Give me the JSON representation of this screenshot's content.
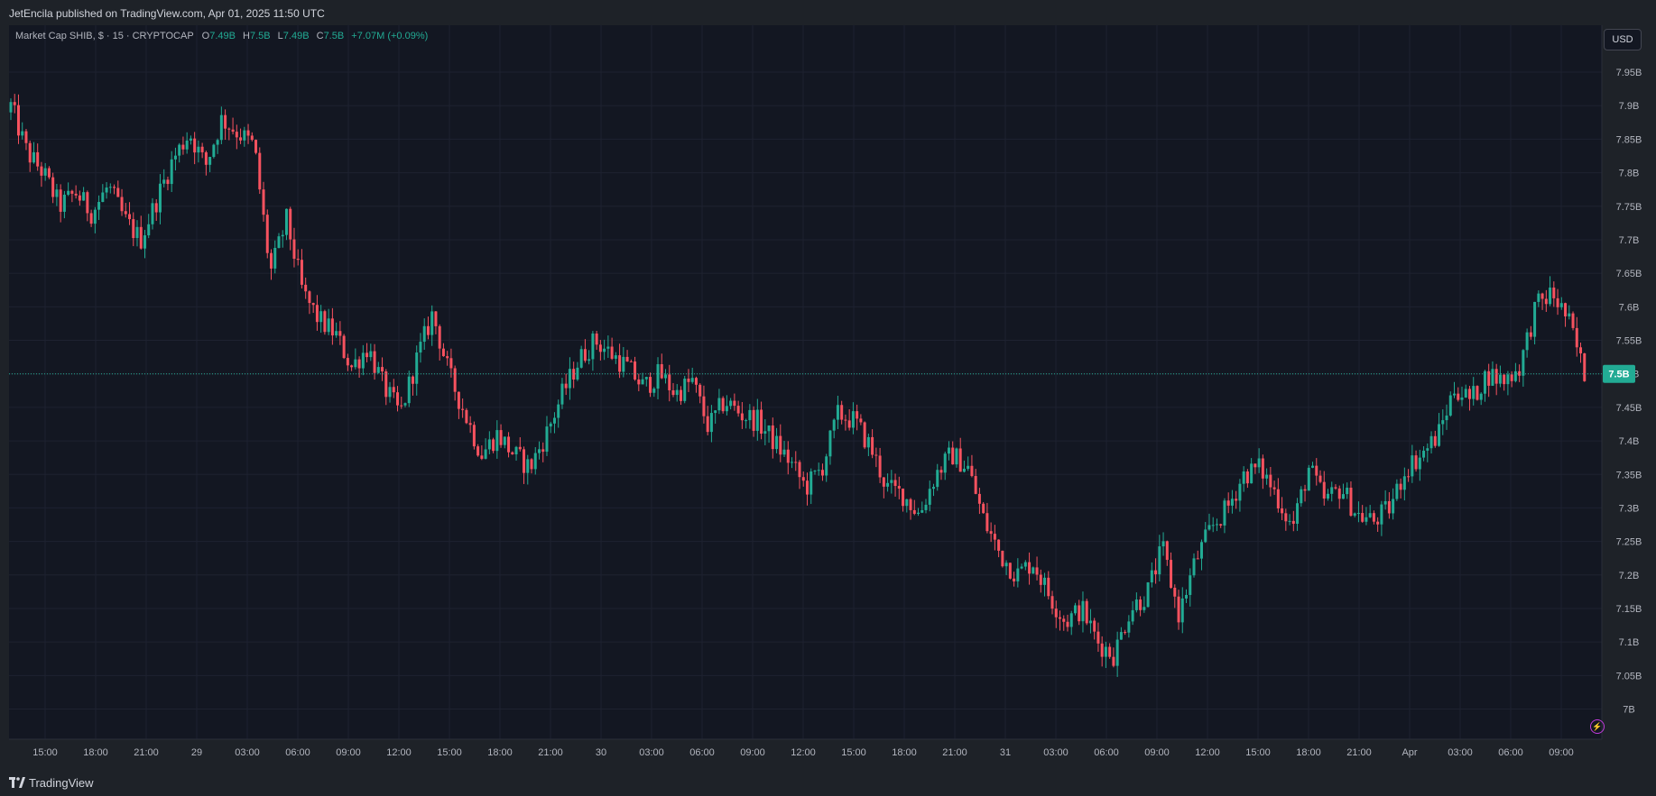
{
  "header": {
    "publisher": "JetEncila published on TradingView.com, Apr 01, 2025 11:50 UTC"
  },
  "legend": {
    "symbol": "Market Cap SHIB, $ · 15 · CRYPTOCAP",
    "o_label": "O",
    "o_value": "7.49B",
    "h_label": "H",
    "h_value": "7.5B",
    "l_label": "L",
    "l_value": "7.49B",
    "c_label": "C",
    "c_value": "7.5B",
    "change": "+7.07M (+0.09%)"
  },
  "currency_button": "USD",
  "footer": {
    "brand": "TradingView"
  },
  "colors": {
    "up": "#22ab94",
    "down": "#f7525f",
    "background": "#131722",
    "grid": "#1e2230"
  },
  "chart_data": {
    "type": "candlestick",
    "y_unit": "B",
    "ylim": [
      6.955,
      8.02
    ],
    "yticks": [
      "7B",
      "7.05B",
      "7.1B",
      "7.15B",
      "7.2B",
      "7.25B",
      "7.3B",
      "7.35B",
      "7.4B",
      "7.45B",
      "7.5B",
      "7.55B",
      "7.6B",
      "7.65B",
      "7.7B",
      "7.75B",
      "7.8B",
      "7.85B",
      "7.9B",
      "7.95B"
    ],
    "xticks": [
      "15:00",
      "18:00",
      "21:00",
      "29",
      "03:00",
      "06:00",
      "09:00",
      "12:00",
      "15:00",
      "18:00",
      "21:00",
      "30",
      "03:00",
      "06:00",
      "09:00",
      "12:00",
      "15:00",
      "18:00",
      "21:00",
      "31",
      "03:00",
      "06:00",
      "09:00",
      "12:00",
      "15:00",
      "18:00",
      "21:00",
      "Apr",
      "03:00",
      "06:00",
      "09:00"
    ],
    "last_price": 7.5,
    "last_price_label": "7.5B",
    "close_path": [
      7.9,
      7.83,
      7.8,
      7.75,
      7.77,
      7.74,
      7.78,
      7.73,
      7.7,
      7.76,
      7.82,
      7.86,
      7.81,
      7.88,
      7.86,
      7.84,
      7.65,
      7.73,
      7.62,
      7.58,
      7.56,
      7.51,
      7.54,
      7.48,
      7.44,
      7.52,
      7.59,
      7.5,
      7.44,
      7.38,
      7.41,
      7.38,
      7.36,
      7.41,
      7.47,
      7.52,
      7.55,
      7.53,
      7.51,
      7.48,
      7.5,
      7.47,
      7.49,
      7.42,
      7.46,
      7.44,
      7.43,
      7.4,
      7.37,
      7.33,
      7.36,
      7.44,
      7.43,
      7.39,
      7.33,
      7.32,
      7.29,
      7.35,
      7.38,
      7.36,
      7.28,
      7.23,
      7.2,
      7.22,
      7.17,
      7.13,
      7.15,
      7.1,
      7.08,
      7.15,
      7.17,
      7.24,
      7.14,
      7.22,
      7.27,
      7.3,
      7.35,
      7.36,
      7.32,
      7.27,
      7.36,
      7.31,
      7.33,
      7.29,
      7.28,
      7.3,
      7.36,
      7.38,
      7.41,
      7.48,
      7.46,
      7.5,
      7.49,
      7.51,
      7.6,
      7.62,
      7.58,
      7.5
    ]
  }
}
